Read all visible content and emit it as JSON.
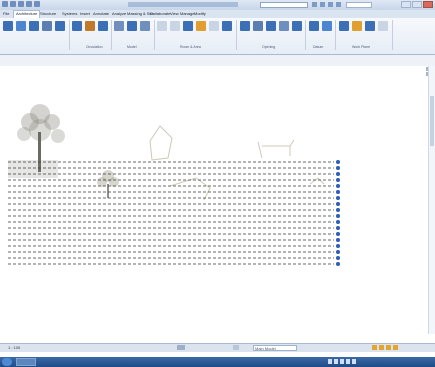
{
  "app": {
    "title": "",
    "search_placeholder": "",
    "signin_label": ""
  },
  "menu": {
    "tabs": [
      "File",
      "Architecture",
      "Structure",
      "Systems",
      "Insert",
      "Annotate",
      "Analyze",
      "Massing & Site",
      "Collaborate",
      "View",
      "Manage",
      "Modify"
    ]
  },
  "ribbon": {
    "groups": [
      {
        "name": "Circulation",
        "buttons": [
          "Railing",
          "Ramp",
          "Stair"
        ]
      },
      {
        "name": "Model",
        "buttons": [
          "Model Text",
          "Model Line",
          "Model Group"
        ]
      },
      {
        "name": "Room & Area",
        "buttons": [
          "Room",
          "Room Separator",
          "Tag Room",
          "Area",
          "Area Boundary",
          "Tag Area"
        ]
      },
      {
        "name": "Opening",
        "buttons": [
          "By Face",
          "Shaft",
          "Wall",
          "Vertical",
          "Dormer"
        ]
      },
      {
        "name": "Datum",
        "buttons": [
          "Level",
          "Grid"
        ]
      },
      {
        "name": "Work Plane",
        "buttons": [
          "Set",
          "Show",
          "Ref Plane",
          "Viewer"
        ]
      }
    ],
    "left_buttons": [
      "Wall",
      "Door",
      "Window",
      "Component",
      "Column",
      "Roof",
      "Ceiling",
      "Floor",
      "Curtain System",
      "Curtain Grid",
      "Mullion"
    ]
  },
  "status": {
    "view_control": "1 : 100",
    "field_value": "",
    "main_model": "Main Model"
  },
  "taskbar": {
    "clock": ""
  },
  "colors": {
    "ribbon_blue": "#3b6fb6",
    "ribbon_orange": "#e0a030",
    "grid_line": "#3a3a3a",
    "level_marker": "#2b5fb8",
    "taskbar": "#1f4a86"
  }
}
